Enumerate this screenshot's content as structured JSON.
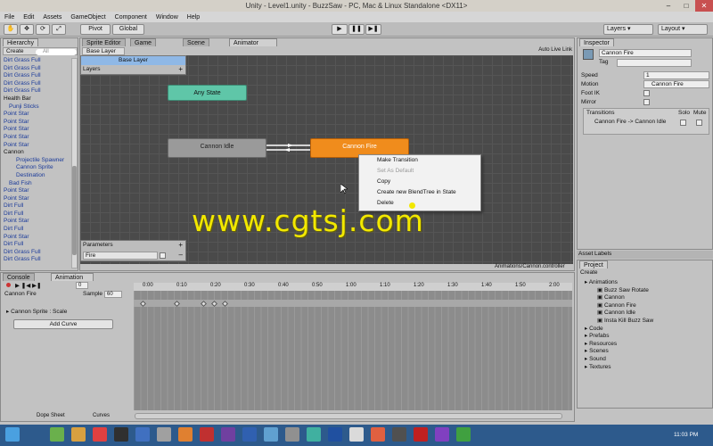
{
  "window": {
    "title": "Unity - Level1.unity - BuzzSaw - PC, Mac & Linux Standalone <DX11>"
  },
  "menu": [
    "File",
    "Edit",
    "Assets",
    "GameObject",
    "Component",
    "Window",
    "Help"
  ],
  "toolbar": {
    "pivot": "Pivot",
    "global": "Global",
    "layers": "Layers",
    "layout": "Layout"
  },
  "hierarchy": {
    "tab": "Hierarchy",
    "create": "Create",
    "search": "All",
    "items": [
      "Dirt Grass Full",
      "Dirt Grass Full",
      "Dirt Grass Full",
      "Dirt Grass Full",
      "Dirt Grass Full",
      "Health Bar",
      "Punji Sticks",
      "Point Star",
      "Point Star",
      "Point Star",
      "Point Star",
      "Point Star",
      "Cannon",
      "Projectile Spawner",
      "Cannon Sprite",
      "Destination",
      "Bad Fish",
      "Point Star",
      "Point Star",
      "Dirt Full",
      "Dirt Full",
      "Point Star",
      "Dirt Full",
      "Point Star",
      "Dirt Full",
      "Dirt Grass Full",
      "Dirt Grass Full"
    ]
  },
  "animator": {
    "tabs": [
      "Sprite Editor",
      "Game",
      "Scene",
      "Animator"
    ],
    "base_layer_tab": "Base Layer",
    "base_layer": "Base Layer",
    "layers_label": "Layers",
    "auto_live_link": "Auto Live Link",
    "states": {
      "any": "Any State",
      "idle": "Cannon Idle",
      "fire": "Cannon Fire"
    },
    "parameters_label": "Parameters",
    "param_name": "Fire",
    "path": "Animations/Cannon.controller"
  },
  "context_menu": [
    "Make Transition",
    "Set As Default",
    "Copy",
    "Create new BlendTree in State",
    "Delete"
  ],
  "inspector": {
    "tab": "Inspector",
    "name": "Cannon Fire",
    "tag": "Tag",
    "speed_label": "Speed",
    "speed": "1",
    "motion_label": "Motion",
    "motion": "Cannon Fire",
    "footik": "Foot IK",
    "mirror": "Mirror",
    "transitions": "Transitions",
    "solo": "Solo",
    "mute": "Mute",
    "transition_item": "Cannon Fire -> Cannon Idle"
  },
  "asset_labels": "Asset Labels",
  "project": {
    "tab": "Project",
    "create": "Create",
    "items": [
      "Animations",
      "Buzz Saw Rotate",
      "Cannon",
      "Cannon Fire",
      "Cannon Idle",
      "Insta Kill Buzz Saw",
      "Code",
      "Prefabs",
      "Resources",
      "Scenes",
      "Sound",
      "Textures"
    ]
  },
  "bottom": {
    "tabs": [
      "Console",
      "Animation"
    ],
    "clip": "Cannon Fire",
    "sample_label": "Sample",
    "sample": "60",
    "frame": "0",
    "track": "Cannon Sprite : Scale",
    "add_curve": "Add Curve",
    "dope_sheet": "Dope Sheet",
    "curves": "Curves",
    "timeline": [
      "0:00",
      "0:10",
      "0:20",
      "0:30",
      "0:40",
      "0:50",
      "1:00",
      "1:10",
      "1:20",
      "1:30",
      "1:40",
      "1:50",
      "2:00"
    ]
  },
  "taskbar": {
    "clock": "11:03 PM"
  },
  "watermark": "www.cgtsj.com",
  "colors": {
    "any_state": "#5fc6a8",
    "idle": "#9a9a9a",
    "fire": "#f08c1c",
    "grid": "#4a4a4a",
    "taskbar": "#2d5a8c",
    "watermark": "#f2e800"
  }
}
